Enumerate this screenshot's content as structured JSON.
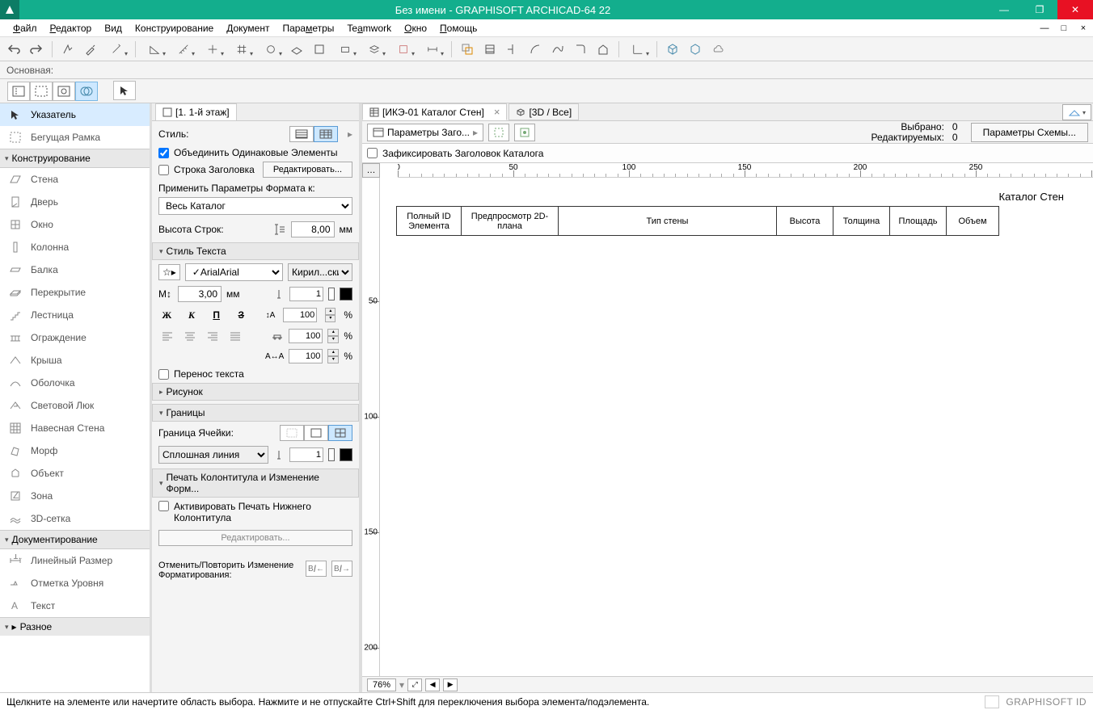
{
  "title": "Без имени - GRAPHISOFT ARCHICAD-64 22",
  "menu": [
    "Файл",
    "Редактор",
    "Вид",
    "Конструирование",
    "Документ",
    "Параметры",
    "Teamwork",
    "Окно",
    "Помощь"
  ],
  "toolbar2_label": "Основная:",
  "toolbox": {
    "groups": [
      {
        "items": [
          {
            "label": "Указатель",
            "active": true
          },
          {
            "label": "Бегущая Рамка"
          }
        ]
      },
      {
        "title": "Конструирование",
        "items": [
          {
            "label": "Стена"
          },
          {
            "label": "Дверь"
          },
          {
            "label": "Окно"
          },
          {
            "label": "Колонна"
          },
          {
            "label": "Балка"
          },
          {
            "label": "Перекрытие"
          },
          {
            "label": "Лестница"
          },
          {
            "label": "Ограждение"
          },
          {
            "label": "Крыша"
          },
          {
            "label": "Оболочка"
          },
          {
            "label": "Световой Люк"
          },
          {
            "label": "Навесная Стена"
          },
          {
            "label": "Морф"
          },
          {
            "label": "Объект"
          },
          {
            "label": "Зона"
          },
          {
            "label": "3D-сетка"
          }
        ]
      },
      {
        "title": "Документирование",
        "items": [
          {
            "label": "Линейный Размер"
          },
          {
            "label": "Отметка Уровня"
          },
          {
            "label": "Текст"
          }
        ]
      },
      {
        "title": "Разное",
        "items": []
      }
    ]
  },
  "props_tab": "[1. 1-й этаж]",
  "props": {
    "style_label": "Стиль:",
    "merge_same": "Объединить Одинаковые Элементы",
    "header_row": "Строка Заголовка",
    "edit_btn": "Редактировать...",
    "apply_fmt": "Применить Параметры Формата к:",
    "apply_fmt_value": "Весь Каталог",
    "row_height": "Высота Строк:",
    "row_height_val": "8,00",
    "mm": "мм",
    "text_style": "Стиль Текста",
    "font": "Arial",
    "script": "Кирил...ский",
    "size_val": "3,00",
    "pen_val": "1",
    "p100_a": "100",
    "p100_b": "100",
    "p100_c": "100",
    "pct": "%",
    "wrap": "Перенос текста",
    "picture": "Рисунок",
    "borders": "Границы",
    "cell_border": "Граница Ячейки:",
    "line_type": "Сплошная линия",
    "line_pen": "1",
    "footer": "Печать Колонтитула и Изменение Форм...",
    "activate_footer": "Активировать Печать Нижнего Колонтитула",
    "edit2": "Редактировать...",
    "undo_label": "Отменить/Повторить Изменение Форматирования:",
    "bi": "B /"
  },
  "doc_tabs": {
    "active": "[ИКЭ-01 Каталог Стен]",
    "other": "[3D / Все]"
  },
  "doc_toolbar": {
    "params": "Параметры Заго...",
    "selected": "Выбрано:",
    "selected_n": "0",
    "editable": "Редактируемых:",
    "editable_n": "0",
    "scheme": "Параметры Схемы..."
  },
  "doc_opts": {
    "fix_header": "Зафиксировать Заголовок Каталога"
  },
  "ruler_h": [
    0,
    50,
    100,
    150,
    200,
    250
  ],
  "ruler_v": [
    50,
    100,
    150,
    200
  ],
  "catalog": {
    "title": "Каталог Стен",
    "cols": [
      "Полный ID Элемента",
      "Предпросмотр 2D-плана",
      "Тип стены",
      "Высота",
      "Толщина",
      "Площадь",
      "Объем"
    ],
    "widths": [
      80,
      120,
      270,
      70,
      70,
      70,
      65
    ]
  },
  "zoom": "76%",
  "status": "Щелкните на элементе или начертите область выбора. Нажмите и не отпускайте Ctrl+Shift для переключения выбора элемента/подэлемента.",
  "gs_id": "GRAPHISOFT ID"
}
